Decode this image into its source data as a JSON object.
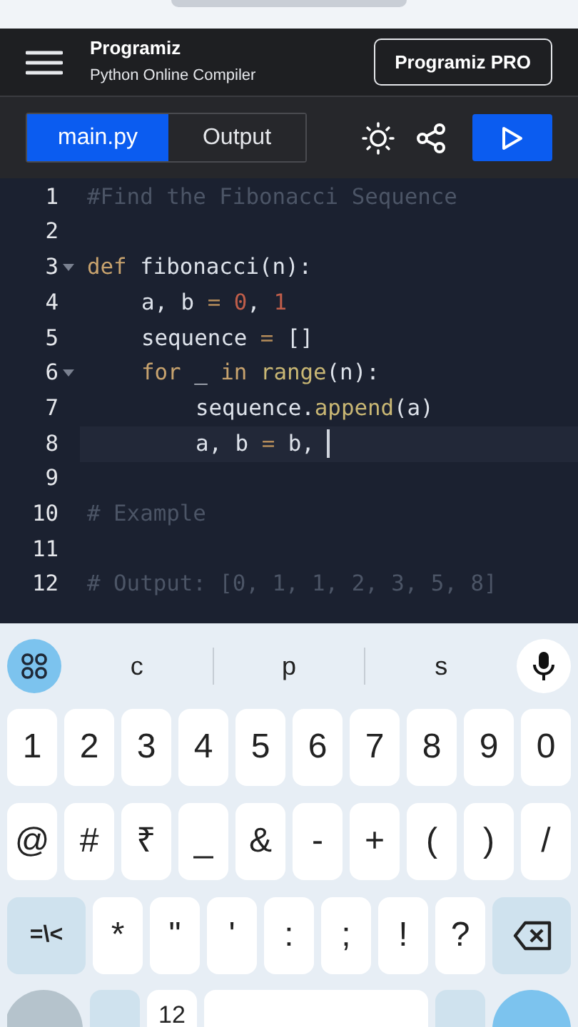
{
  "header": {
    "logo": "Programiz",
    "subtitle": "Python Online Compiler",
    "pro_button": "Programiz PRO"
  },
  "tabs": [
    {
      "label": "main.py",
      "selected": true
    },
    {
      "label": "Output",
      "selected": false
    }
  ],
  "editor": {
    "lines": [
      {
        "number": "1",
        "fold": false,
        "selected": false,
        "tokens": [
          {
            "kind": "comment",
            "text": "#Find the Fibonacci Sequence"
          }
        ]
      },
      {
        "number": "2",
        "fold": false,
        "selected": false
      },
      {
        "number": "3",
        "fold": true,
        "selected": false,
        "tokens": [
          {
            "kind": "keyword",
            "text": "def"
          },
          {
            "kind": "plain",
            "text": " fibonacci(n):"
          }
        ],
        "children": [
          {
            "number": "4",
            "fold": false,
            "selected": false,
            "tokens": [
              {
                "kind": "plain",
                "text": "a, b "
              },
              {
                "kind": "operator",
                "text": "= "
              },
              {
                "kind": "number",
                "text": "0"
              },
              {
                "kind": "plain",
                "text": ", "
              },
              {
                "kind": "number",
                "text": "1"
              }
            ]
          },
          {
            "number": "5",
            "fold": false,
            "selected": false,
            "tokens": [
              {
                "kind": "plain",
                "text": "sequence "
              },
              {
                "kind": "operator",
                "text": "="
              },
              {
                "kind": "plain",
                "text": " []"
              }
            ]
          },
          {
            "number": "6",
            "fold": true,
            "selected": false,
            "tokens": [
              {
                "kind": "keyword",
                "text": "for"
              },
              {
                "kind": "plain",
                "text": " _ "
              },
              {
                "kind": "keyword",
                "text": "in"
              },
              {
                "kind": "function",
                "text": " range"
              },
              {
                "kind": "plain",
                "text": "(n):"
              }
            ],
            "children": [
              {
                "number": "7",
                "fold": false,
                "selected": false,
                "tokens": [
                  {
                    "kind": "plain",
                    "text": "sequence."
                  },
                  {
                    "kind": "function",
                    "text": "append"
                  },
                  {
                    "kind": "plain",
                    "text": "(a)"
                  }
                ]
              },
              {
                "number": "8",
                "fold": false,
                "selected": true,
                "tokens": [
                  {
                    "kind": "plain",
                    "text": "a, b "
                  },
                  {
                    "kind": "operator",
                    "text": "="
                  },
                  {
                    "kind": "plain",
                    "text": " b,"
                  }
                ]
              }
            ]
          }
        ]
      },
      {
        "number": "9",
        "fold": false,
        "selected": false
      },
      {
        "number": "10",
        "fold": false,
        "selected": false,
        "tokens": [
          {
            "kind": "comment",
            "text": "# Example"
          }
        ]
      },
      {
        "number": "11",
        "fold": false,
        "selected": false
      },
      {
        "number": "12",
        "fold": false,
        "selected": false,
        "tokens": [
          {
            "kind": "comment",
            "text": "# Output: [0, 1, 1, 2, 3, 5, 8]"
          }
        ]
      }
    ]
  },
  "keyboard": {
    "suggestions": [
      "c",
      "p",
      "s"
    ],
    "rows": [
      [
        {
          "kind": "key",
          "label": "1"
        },
        {
          "kind": "key",
          "label": "2"
        },
        {
          "kind": "key",
          "label": "3"
        },
        {
          "kind": "key",
          "label": "4"
        },
        {
          "kind": "key",
          "label": "5"
        },
        {
          "kind": "key",
          "label": "6"
        },
        {
          "kind": "key",
          "label": "7"
        },
        {
          "kind": "key",
          "label": "8"
        },
        {
          "kind": "key",
          "label": "9"
        },
        {
          "kind": "key",
          "label": "0"
        }
      ],
      [
        {
          "kind": "key",
          "label": "@"
        },
        {
          "kind": "key",
          "label": "#"
        },
        {
          "kind": "key",
          "label": "₹"
        },
        {
          "kind": "key",
          "label": "_"
        },
        {
          "kind": "key",
          "label": "&"
        },
        {
          "kind": "key",
          "label": "-"
        },
        {
          "kind": "key",
          "label": "+"
        },
        {
          "kind": "key",
          "label": "("
        },
        {
          "kind": "key",
          "label": ")"
        },
        {
          "kind": "key",
          "label": "/"
        }
      ],
      [
        {
          "kind": "mode",
          "label": "=\\<"
        },
        {
          "kind": "key",
          "label": "*"
        },
        {
          "kind": "key",
          "label": "\""
        },
        {
          "kind": "key",
          "label": "'"
        },
        {
          "kind": "key",
          "label": ":"
        },
        {
          "kind": "key",
          "label": ";"
        },
        {
          "kind": "key",
          "label": "!"
        },
        {
          "kind": "key",
          "label": "?"
        },
        {
          "kind": "backspace"
        }
      ]
    ],
    "bottom_row": [
      {
        "kind": "round"
      },
      {
        "kind": "shade"
      },
      {
        "kind": "key",
        "label": "12"
      },
      {
        "kind": "space"
      },
      {
        "kind": "shade"
      },
      {
        "kind": "enter"
      }
    ]
  }
}
